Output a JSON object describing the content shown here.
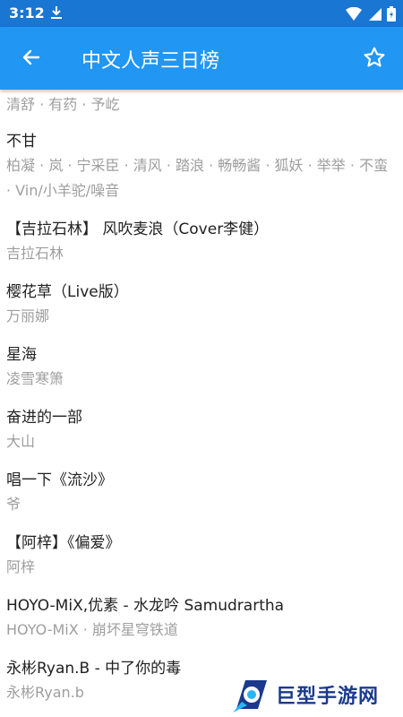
{
  "status_bar": {
    "time": "3:12"
  },
  "app_bar": {
    "title": "中文人声三日榜"
  },
  "songs": [
    {
      "title": "",
      "artist": "清舒 · 有药 · 予屹"
    },
    {
      "title": "不甘",
      "artist": "柏凝 · 岚 · 宁采臣 · 清风 · 踏浪 · 畅畅酱 · 狐妖 · 举举 · 不蛮 · Vin/小羊驼/噪音"
    },
    {
      "title": "【吉拉石林】 风吹麦浪（Cover李健）",
      "artist": "吉拉石林"
    },
    {
      "title": "樱花草（Live版）",
      "artist": "万丽娜"
    },
    {
      "title": "星海",
      "artist": "凌雪寒箫"
    },
    {
      "title": "奋进的一部",
      "artist": "大山"
    },
    {
      "title": "唱一下《流沙》",
      "artist": "爷"
    },
    {
      "title": "【阿梓】《偏爱》",
      "artist": "阿梓"
    },
    {
      "title": "HOYO-MiX,优素 - 水龙吟 Samudrartha",
      "artist": "HOYO-MiX · 崩坏星穹铁道"
    },
    {
      "title": "永彬Ryan.B - 中了你的毒",
      "artist": "永彬Ryan.b"
    }
  ],
  "watermark": {
    "text": "巨型手游网"
  },
  "colors": {
    "status_bar": "#1976d2",
    "app_bar": "#2196f3",
    "title_text": "#212121",
    "artist_text": "#9e9e9e"
  }
}
